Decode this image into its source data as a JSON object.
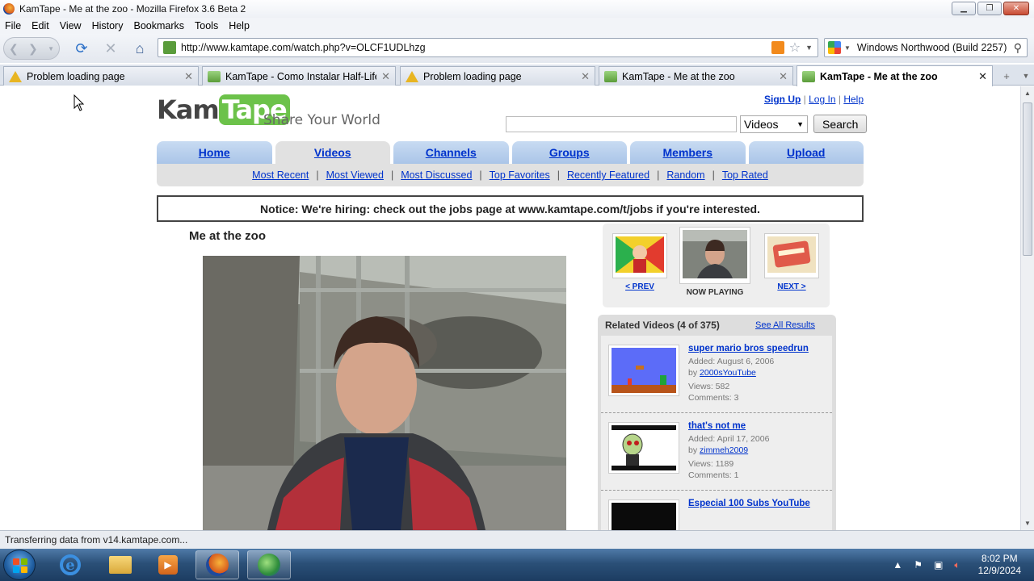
{
  "window": {
    "title": "KamTape - Me at the zoo - Mozilla Firefox 3.6 Beta 2"
  },
  "menu": [
    "File",
    "Edit",
    "View",
    "History",
    "Bookmarks",
    "Tools",
    "Help"
  ],
  "nav": {
    "url": "http://www.kamtape.com/watch.php?v=OLCF1UDLhzg",
    "search_engine_text": "Windows Northwood (Build 2257)"
  },
  "tabs": [
    {
      "label": "Problem loading page",
      "icon": "warning-icon"
    },
    {
      "label": "KamTape - Como Instalar Half-Life...",
      "icon": "kamtape-icon"
    },
    {
      "label": "Problem loading page",
      "icon": "warning-icon"
    },
    {
      "label": "KamTape - Me at the zoo",
      "icon": "kamtape-icon"
    },
    {
      "label": "KamTape - Me at the zoo",
      "icon": "kamtape-icon",
      "active": true
    }
  ],
  "site": {
    "logo_left": "Kam",
    "logo_right": "Tape",
    "tagline": "Share Your World",
    "links": {
      "signup": "Sign Up",
      "login": "Log In",
      "help": "Help",
      "sep": "|"
    },
    "search": {
      "value": "",
      "category": "Videos",
      "button": "Search"
    },
    "main_tabs": [
      "Home",
      "Videos",
      "Channels",
      "Groups",
      "Members",
      "Upload"
    ],
    "sub_nav": [
      "Most Recent",
      "Most Viewed",
      "Most Discussed",
      "Top Favorites",
      "Recently Featured",
      "Random",
      "Top Rated"
    ],
    "notice": "Notice: We're hiring: check out the jobs page at www.kamtape.com/t/jobs if you're interested."
  },
  "video": {
    "title": "Me at the zoo"
  },
  "prevnext": {
    "prev": "< PREV",
    "now": "NOW PLAYING",
    "next": "NEXT >"
  },
  "related": {
    "header": "Related Videos (4 of 375)",
    "see_all": "See All Results",
    "items": [
      {
        "title": "super mario bros speedrun",
        "added": "Added: August 6, 2006",
        "by_prefix": "by",
        "by": "2000sYouTube",
        "views": "Views: 582",
        "comments": "Comments: 3"
      },
      {
        "title": "that's not me",
        "added": "Added: April 17, 2006",
        "by_prefix": "by",
        "by": "zimmeh2009",
        "views": "Views: 1189",
        "comments": "Comments: 1"
      },
      {
        "title": "Especial 100 Subs YouTube",
        "added": "",
        "by_prefix": "",
        "by": "",
        "views": "",
        "comments": ""
      }
    ]
  },
  "status": "Transferring data from v14.kamtape.com...",
  "clock": {
    "time": "8:02 PM",
    "date": "12/9/2024"
  },
  "colors": {
    "link": "#0033cc",
    "accent_green": "#6cc24a",
    "tab_blue": "#aac5e8"
  }
}
